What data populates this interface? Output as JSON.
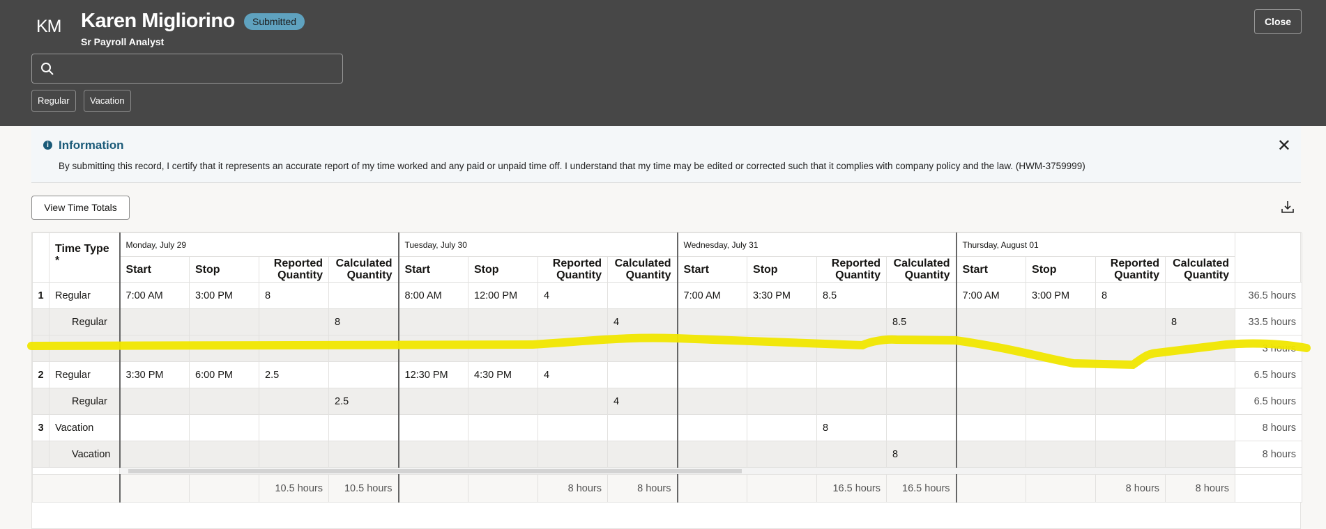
{
  "header": {
    "initials": "KM",
    "name": "Karen Migliorino",
    "status": "Submitted",
    "role": "Sr Payroll Analyst",
    "search_placeholder": "",
    "chips": [
      "Regular",
      "Vacation"
    ],
    "close_label": "Close"
  },
  "info": {
    "title": "Information",
    "text": "By submitting this record, I certify that it represents an accurate report of my time worked and any paid or unpaid time off. I understand that my time may be edited or corrected such that it complies with company policy and the law. (HWM-3759999)"
  },
  "toolbar": {
    "view_totals_label": "View Time Totals"
  },
  "table": {
    "time_type_header": "Time Type",
    "required_mark": "*",
    "days": [
      "Monday, July 29",
      "Tuesday, July 30",
      "Wednesday, July 31",
      "Thursday, August 01"
    ],
    "sub_columns": [
      "Start",
      "Stop",
      "Reported Quantity",
      "Calculated Quantity"
    ],
    "rows": [
      {
        "num": "1",
        "type": "Regular",
        "sub": false,
        "cells": [
          "7:00 AM",
          "3:00 PM",
          "8",
          "",
          "8:00 AM",
          "12:00 PM",
          "4",
          "",
          "7:00 AM",
          "3:30 PM",
          "8.5",
          "",
          "7:00 AM",
          "3:00 PM",
          "8",
          ""
        ],
        "total": "36.5 hours"
      },
      {
        "num": "",
        "type": "Regular",
        "sub": true,
        "cells": [
          "",
          "",
          "",
          "8",
          "",
          "",
          "",
          "4",
          "",
          "",
          "",
          "8.5",
          "",
          "",
          "",
          "8"
        ],
        "total": "33.5 hours"
      },
      {
        "num": "",
        "type": "",
        "sub": true,
        "cells": [
          "",
          "",
          "",
          "",
          "",
          "",
          "",
          "",
          "",
          "",
          "",
          "",
          "",
          "",
          "",
          ""
        ],
        "total": "3 hours"
      },
      {
        "num": "2",
        "type": "Regular",
        "sub": false,
        "cells": [
          "3:30 PM",
          "6:00 PM",
          "2.5",
          "",
          "12:30 PM",
          "4:30 PM",
          "4",
          "",
          "",
          "",
          "",
          "",
          "",
          "",
          "",
          ""
        ],
        "total": "6.5 hours"
      },
      {
        "num": "",
        "type": "Regular",
        "sub": true,
        "cells": [
          "",
          "",
          "",
          "2.5",
          "",
          "",
          "",
          "4",
          "",
          "",
          "",
          "",
          "",
          "",
          "",
          ""
        ],
        "total": "6.5 hours"
      },
      {
        "num": "3",
        "type": "Vacation",
        "sub": false,
        "cells": [
          "",
          "",
          "",
          "",
          "",
          "",
          "",
          "",
          "",
          "",
          "8",
          "",
          "",
          "",
          "",
          ""
        ],
        "total": "8 hours"
      },
      {
        "num": "",
        "type": "Vacation",
        "sub": true,
        "cells": [
          "",
          "",
          "",
          "",
          "",
          "",
          "",
          "",
          "",
          "",
          "",
          "8",
          "",
          "",
          "",
          ""
        ],
        "total": "8 hours"
      }
    ],
    "day_totals": [
      [
        "10.5 hours",
        "10.5 hours"
      ],
      [
        "8 hours",
        "8 hours"
      ],
      [
        "16.5 hours",
        "16.5 hours"
      ],
      [
        "8 hours",
        "8 hours"
      ]
    ]
  },
  "colors": {
    "header_bg": "#474747",
    "badge": "#5fa2bf",
    "info_accent": "#1a5a78",
    "highlight": "#f0e600"
  }
}
